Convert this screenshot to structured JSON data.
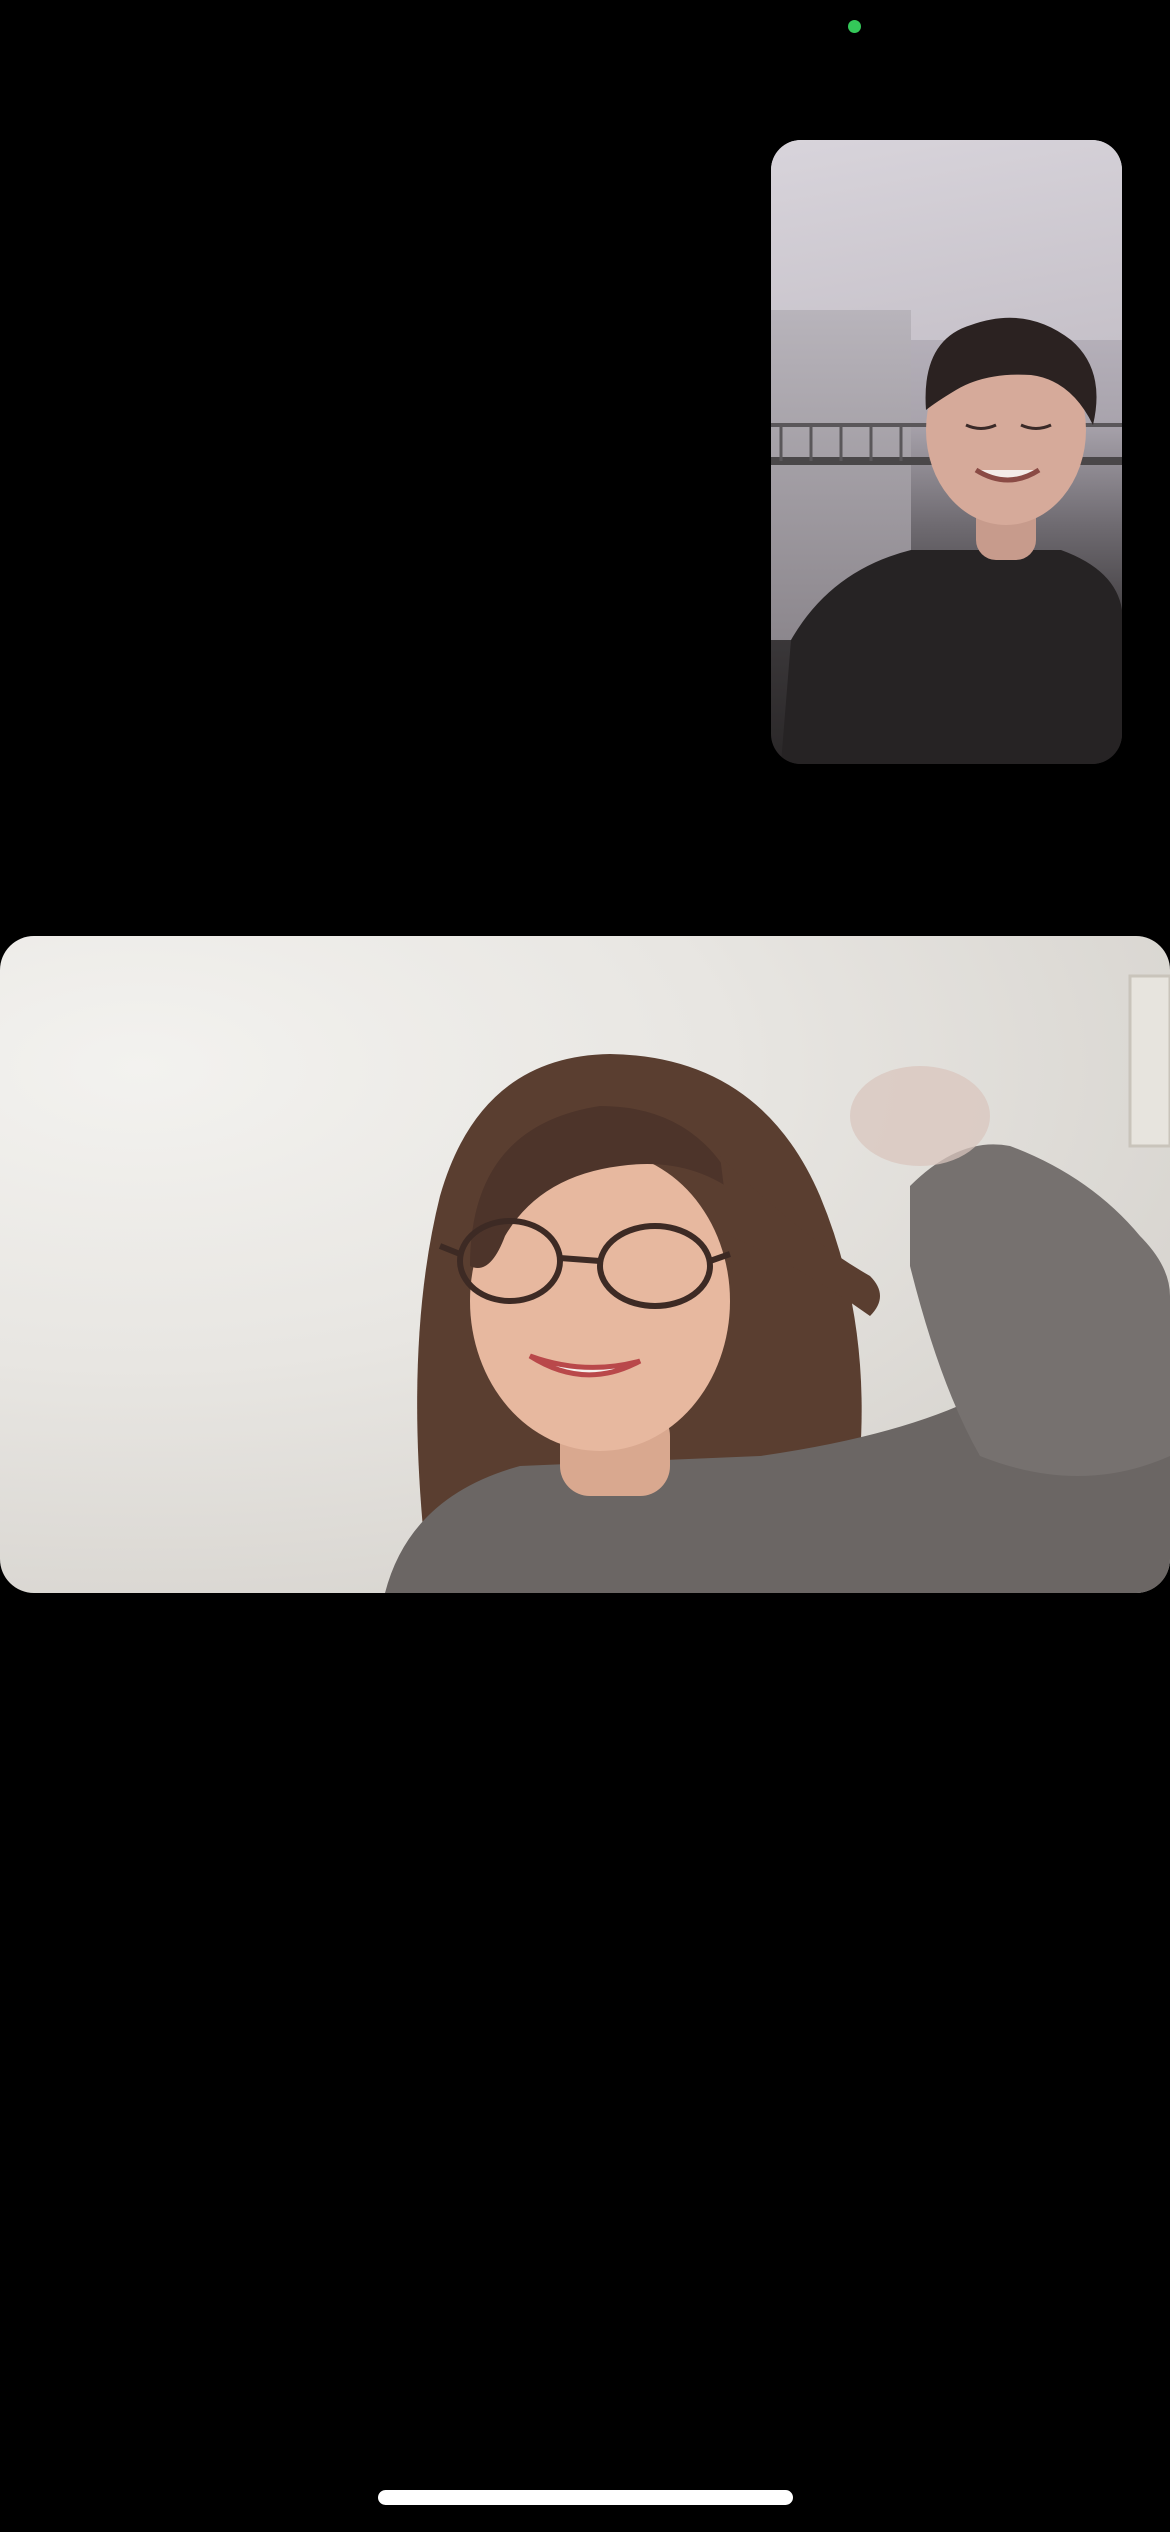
{
  "screen": {
    "background_color": "#000000"
  },
  "status": {
    "camera_indicator_color": "#34c759",
    "camera_indicator_icon": "camera-in-use-dot-icon"
  },
  "self_view": {
    "kind": "local-camera-preview"
  },
  "remote_video": {
    "kind": "remote-participant-video"
  },
  "home_indicator": {
    "color": "#ffffff"
  }
}
